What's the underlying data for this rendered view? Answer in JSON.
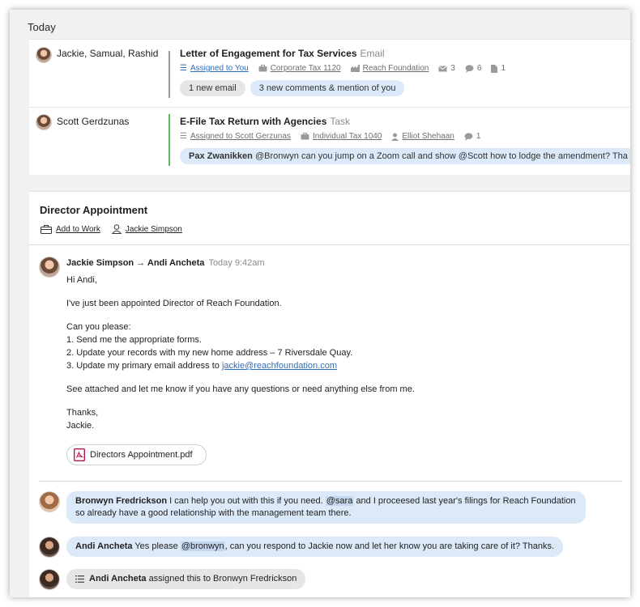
{
  "section": {
    "label": "Today"
  },
  "rows": [
    {
      "names": "Jackie, Samual, Rashid",
      "title": "Letter of Engagement for Tax Services",
      "kind": "Email",
      "assigned": "Assigned to You",
      "entity": "Corporate Tax 1120",
      "client": "Reach Foundation",
      "mail_count": "3",
      "comment_count": "6",
      "doc_count": "1",
      "pill1": "1 new email",
      "pill2": "3 new comments & mention of you"
    },
    {
      "names": "Scott Gerdzunas",
      "title": "E-File Tax Return with Agencies",
      "kind": "Task",
      "assigned": "Assigned to Scott Gerzunas",
      "entity": "Individual Tax 1040",
      "person": "Elliot Shehaan",
      "comment_count": "1",
      "pill_who": "Pax Zwanikken",
      "pill_text": "@Bronwyn can you jump on a Zoom call and show @Scott how to lodge the amendment? Tha"
    }
  ],
  "detail": {
    "title": "Director Appointment",
    "add_to_work": "Add to Work",
    "owner": "Jackie Simpson",
    "message": {
      "from": "Jackie Simpson",
      "arrow": "→",
      "to": "Andi Ancheta",
      "time": "Today 9:42am",
      "greeting": "Hi Andi,",
      "line1": "I've just been appointed Director of Reach Foundation.",
      "ask": "Can you please:",
      "item1": "1. Send me the appropriate forms.",
      "item2": "2. Update your records with my new home address – 7 Riversdale Quay.",
      "item3": "3. Update my primary email address to",
      "email": "jackie@reachfoundation.com",
      "closing": "See attached and let me know if you have any questions or need anything else from me.",
      "thanks": "Thanks,",
      "sign": "Jackie.",
      "attachment": "Directors Appointment.pdf"
    },
    "comments": [
      {
        "who": "Bronwyn Fredrickson",
        "pre": "I can help you out with this if you need.",
        "mention": "@sara",
        "post": "and I proceesed last year's filings for Reach Foundation",
        "line2": "so already have a good relationship with the management team there."
      },
      {
        "who": "Andi Ancheta",
        "pre": "Yes please",
        "mention": "@bronwyn",
        "post": ", can you respond to Jackie now and let her know you are taking care of it? Thanks."
      },
      {
        "who": "Andi Ancheta",
        "text": "assigned this to Bronwyn Fredrickson"
      }
    ]
  },
  "icons": {
    "assigned": "list-icon",
    "entity": "briefcase-icon",
    "client": "building-icon",
    "mail": "mail-icon",
    "comment": "comment-icon",
    "doc": "document-icon",
    "person": "person-icon",
    "pdf": "pdf-icon"
  },
  "colors": {
    "accent": "#2f6fbf",
    "bubble": "#dce9f8",
    "task_bar": "#5cb85c"
  }
}
